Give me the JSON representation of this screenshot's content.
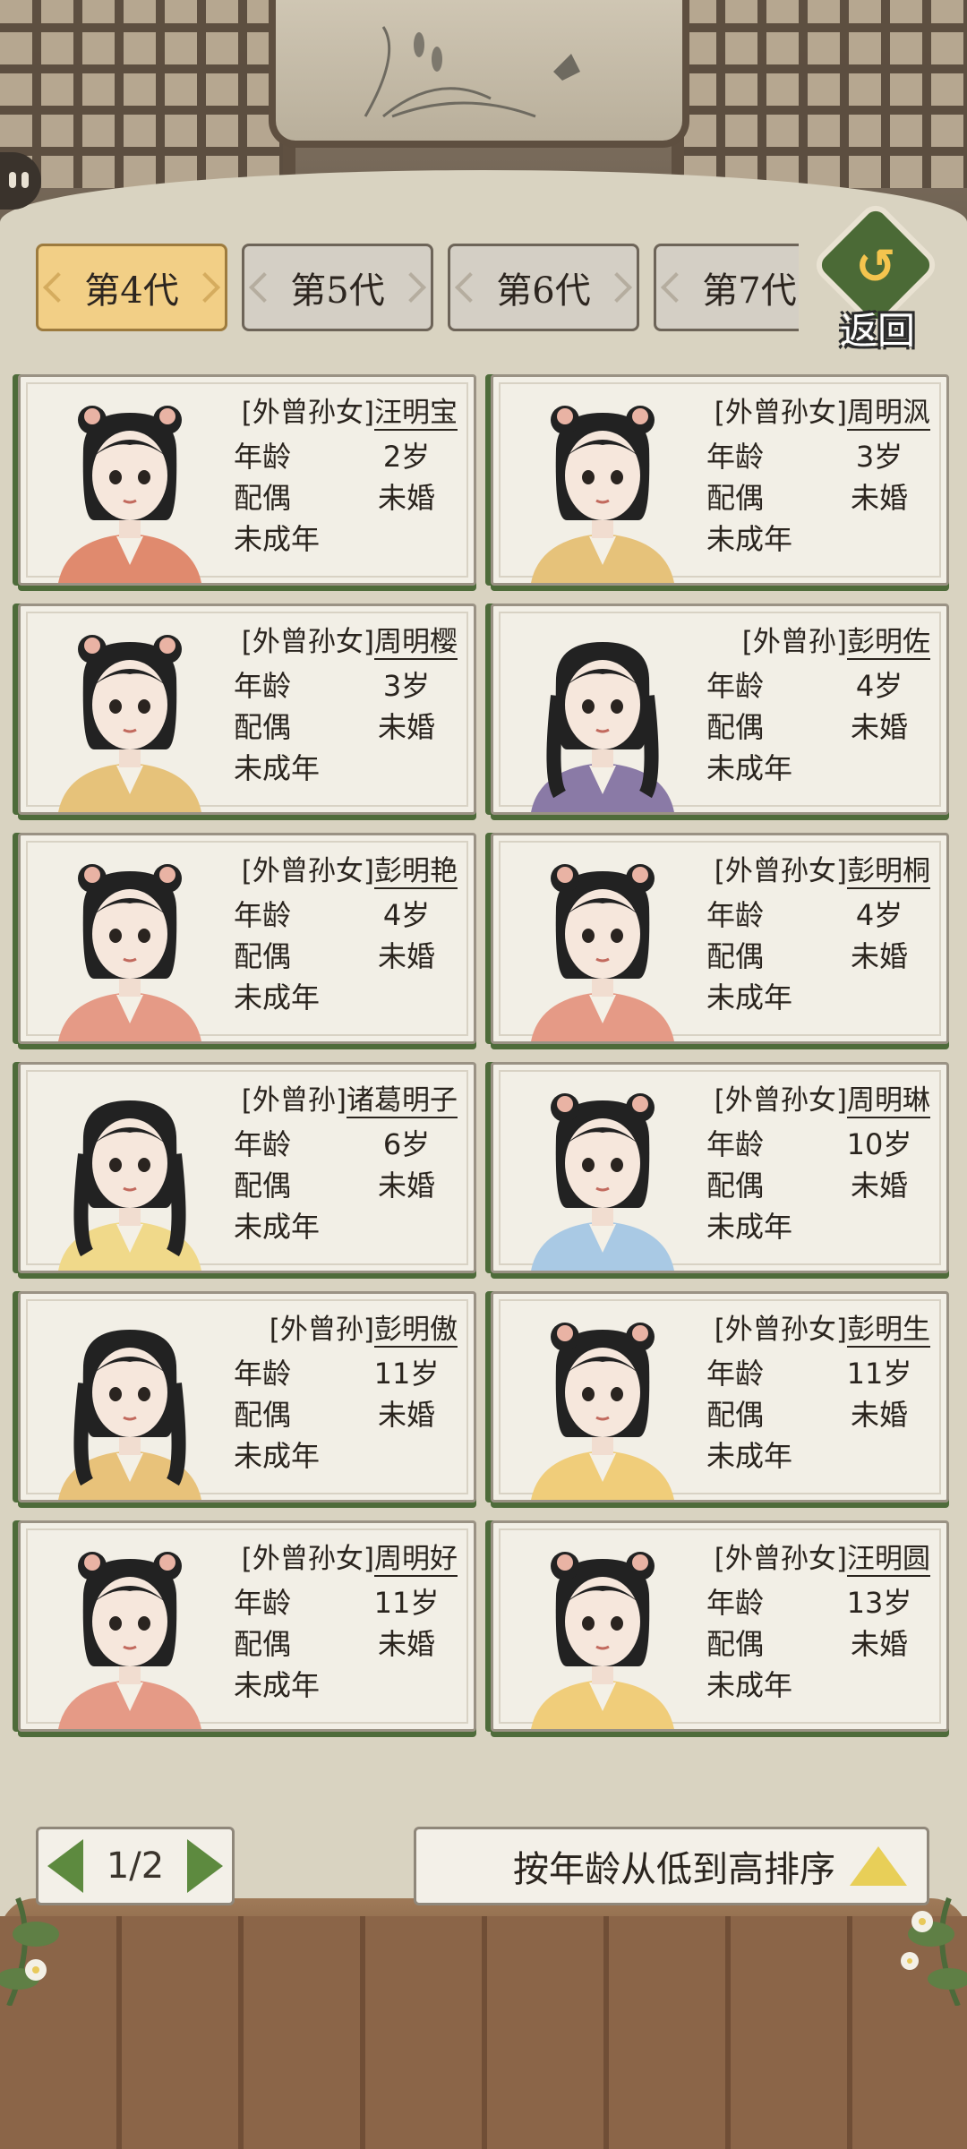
{
  "tabs": [
    {
      "label": "第4代",
      "active": true
    },
    {
      "label": "第5代",
      "active": false
    },
    {
      "label": "第6代",
      "active": false
    },
    {
      "label": "第7代",
      "active": false
    }
  ],
  "back_label": "返回",
  "field_labels": {
    "age": "年龄",
    "spouse": "配偶",
    "status": "未成年"
  },
  "members": [
    {
      "relation": "[外曾孙女]",
      "name": "汪明宝",
      "age": "2岁",
      "spouse": "未婚",
      "status": "未成年",
      "gender": "female",
      "outfit": "#e08a6e"
    },
    {
      "relation": "[外曾孙女]",
      "name": "周明沨",
      "age": "3岁",
      "spouse": "未婚",
      "status": "未成年",
      "gender": "female",
      "outfit": "#e6c27a"
    },
    {
      "relation": "[外曾孙女]",
      "name": "周明樱",
      "age": "3岁",
      "spouse": "未婚",
      "status": "未成年",
      "gender": "female",
      "outfit": "#e6c27a"
    },
    {
      "relation": "[外曾孙]",
      "name": "彭明佐",
      "age": "4岁",
      "spouse": "未婚",
      "status": "未成年",
      "gender": "male",
      "outfit": "#8a7aa6"
    },
    {
      "relation": "[外曾孙女]",
      "name": "彭明艳",
      "age": "4岁",
      "spouse": "未婚",
      "status": "未成年",
      "gender": "female",
      "outfit": "#e59a86"
    },
    {
      "relation": "[外曾孙女]",
      "name": "彭明桐",
      "age": "4岁",
      "spouse": "未婚",
      "status": "未成年",
      "gender": "female",
      "outfit": "#e59a86"
    },
    {
      "relation": "[外曾孙]",
      "name": "诸葛明子",
      "age": "6岁",
      "spouse": "未婚",
      "status": "未成年",
      "gender": "male",
      "outfit": "#f0d98a"
    },
    {
      "relation": "[外曾孙女]",
      "name": "周明琳",
      "age": "10岁",
      "spouse": "未婚",
      "status": "未成年",
      "gender": "female",
      "outfit": "#a9c9e4"
    },
    {
      "relation": "[外曾孙]",
      "name": "彭明傲",
      "age": "11岁",
      "spouse": "未婚",
      "status": "未成年",
      "gender": "male",
      "outfit": "#e8c27a"
    },
    {
      "relation": "[外曾孙女]",
      "name": "彭明生",
      "age": "11岁",
      "spouse": "未婚",
      "status": "未成年",
      "gender": "female",
      "outfit": "#f0cd7a"
    },
    {
      "relation": "[外曾孙女]",
      "name": "周明好",
      "age": "11岁",
      "spouse": "未婚",
      "status": "未成年",
      "gender": "female",
      "outfit": "#e59a86"
    },
    {
      "relation": "[外曾孙女]",
      "name": "汪明圆",
      "age": "13岁",
      "spouse": "未婚",
      "status": "未成年",
      "gender": "female",
      "outfit": "#f0cd7a"
    }
  ],
  "pager": {
    "text": "1/2"
  },
  "sort_label": "按年龄从低到高排序",
  "colors": {
    "active_tab": "#f2cf86",
    "accent_green": "#4e6b3a",
    "sort_triangle": "#e8cf58"
  }
}
